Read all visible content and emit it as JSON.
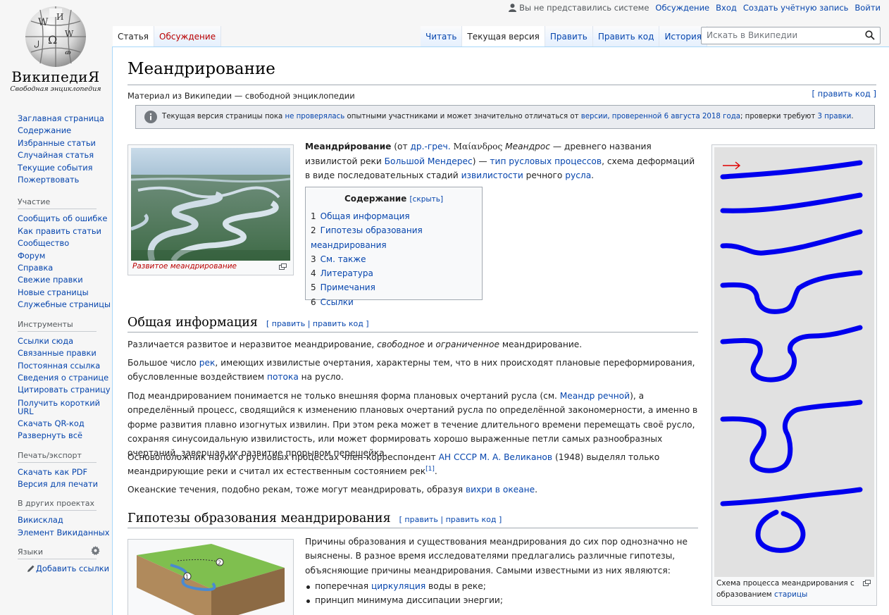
{
  "personal": {
    "anon": "Вы не представились системе",
    "discussion": "Обсуждение",
    "login": "Вход",
    "create_account": "Создать учётную запись",
    "logout": "Войти"
  },
  "logo": {
    "wordmark": "ВикипедиЯ",
    "tagline": "Свободная энциклопедия"
  },
  "sidebar": {
    "nav": [
      "Заглавная страница",
      "Содержание",
      "Избранные статьи",
      "Случайная статья",
      "Текущие события",
      "Пожертвовать"
    ],
    "participation": {
      "title": "Участие",
      "items": [
        "Сообщить об ошибке",
        "Как править статьи",
        "Сообщество",
        "Форум",
        "Справка",
        "Свежие правки",
        "Новые страницы",
        "Служебные страницы"
      ]
    },
    "tools": {
      "title": "Инструменты",
      "items": [
        "Ссылки сюда",
        "Связанные правки",
        "Постоянная ссылка",
        "Сведения о странице",
        "Цитировать страницу",
        "Получить короткий URL",
        "Скачать QR-код",
        "Развернуть всё"
      ]
    },
    "print": {
      "title": "Печать/экспорт",
      "items": [
        "Скачать как PDF",
        "Версия для печати"
      ]
    },
    "projects": {
      "title": "В других проектах",
      "items": [
        "Викисклад",
        "Элемент Викиданных"
      ]
    },
    "languages": {
      "title": "Языки",
      "add_links": "Добавить ссылки"
    }
  },
  "tabs": {
    "article": "Статья",
    "talk": "Обсуждение",
    "read": "Читать",
    "current": "Текущая версия",
    "edit": "Править",
    "edit_code": "Править код",
    "history": "История"
  },
  "search": {
    "placeholder": "Искать в Википедии"
  },
  "article": {
    "title": "Меандрирование",
    "site_sub": "Материал из Википедии — свободной энциклопедии",
    "edit_code_top": "[ править код ]",
    "notice": {
      "t1": "Текущая версия страницы пока ",
      "l1": "не проверялась",
      "t2": " опытными участниками и может значительно отличаться от ",
      "l2": "версии, проверенной 6 августа 2018 года",
      "t3": "; проверки требуют ",
      "l3": "3 правки",
      "t4": "."
    },
    "thumb1_caption": "Развитое меандрирование",
    "intro": {
      "bold": "Меандри́рование",
      "t1": " (от ",
      "l1": "др.-греч.",
      "greek": " Μαίανδρος",
      "ital": " Меандрос",
      "t2": " — древнего названия извилистой реки ",
      "l2": "Большой Мендерес",
      "t3": ") — ",
      "l3": "тип русловых процессов",
      "t4": ", схема деформаций в виде последовательных стадий ",
      "l4": "извилистости",
      "t5": " речного ",
      "l5": "русла",
      "t6": "."
    },
    "toc": {
      "title": "Содержание",
      "hide": "[скрыть]",
      "items": [
        {
          "num": "1",
          "label": "Общая информация"
        },
        {
          "num": "2",
          "label": "Гипотезы образования меандрирования"
        },
        {
          "num": "3",
          "label": "См. также"
        },
        {
          "num": "4",
          "label": "Литература"
        },
        {
          "num": "5",
          "label": "Примечания"
        },
        {
          "num": "6",
          "label": "Ссылки"
        }
      ]
    },
    "sec1": {
      "title": "Общая информация",
      "edit": "[ править | править код ]",
      "p1": {
        "t1": "Различается развитое и неразвитое меандрирование, ",
        "i1": "свободное",
        "t2": " и ",
        "i2": "ограниченное",
        "t3": " меандрирование."
      },
      "p2": {
        "t1": "Большое число ",
        "l1": "рек",
        "t2": ", имеющих извилистые очертания, характерны тем, что в них происходят плановые переформирования, обусловленные воздействием ",
        "l2": "потока",
        "t3": " на русло."
      },
      "p3": {
        "t1": "Под меандрированием понимается не только внешняя форма плановых очертаний русла (см. ",
        "l1": "Меандр речной",
        "t2": "), а определённый процесс, сводящийся к изменению плановых очертаний русла по определённой закономерности, а именно в форме развития плавно изогнутых извилин. При этом река может в течение длительного времени перемещать своё русло, сохраняя синусоидальную извилистость, или может формировать хорошо выраженные петли самых разнообразных очертаний, завершая их развитие прорывом перешейка."
      },
      "p4": {
        "t1": "Основоположник науки о русловых процессах член-корреспондент ",
        "l1": "АН СССР",
        "t2": " ",
        "l2": "М. А. Великанов",
        "t3": " (1948) выделял только меандрирующие реки и считал их естественным состоянием рек",
        "ref": "[1]",
        "t4": "."
      },
      "p5": {
        "t1": "Океанские течения, подобно рекам, тоже могут меандрировать, образуя ",
        "l1": "вихри в океане",
        "t2": "."
      }
    },
    "sec2": {
      "title": "Гипотезы образования меандрирования",
      "edit": "[ править | править код ]",
      "p1": "Причины образования и существования меандрирования до сих пор однозначно не выяснены. В разное время исследователями предлагались различные гипотезы, объясняющие причины меандрирования. Самыми известными из них являются:",
      "li1": {
        "t1": "поперечная ",
        "l1": "циркуляция",
        "t2": " воды в реке;"
      },
      "li2": "принцип минимума диссипации энергии;"
    },
    "thumb2_caption": {
      "t1": "Схема процесса меандрирования с образованием ",
      "l1": "старицы"
    },
    "diagram_labels": {
      "a": "1",
      "b": "2"
    }
  },
  "colors": {
    "link": "#0645ad",
    "redlink": "#ba0000",
    "river_stroke": "#0000ee",
    "arrow": "#e00000"
  }
}
